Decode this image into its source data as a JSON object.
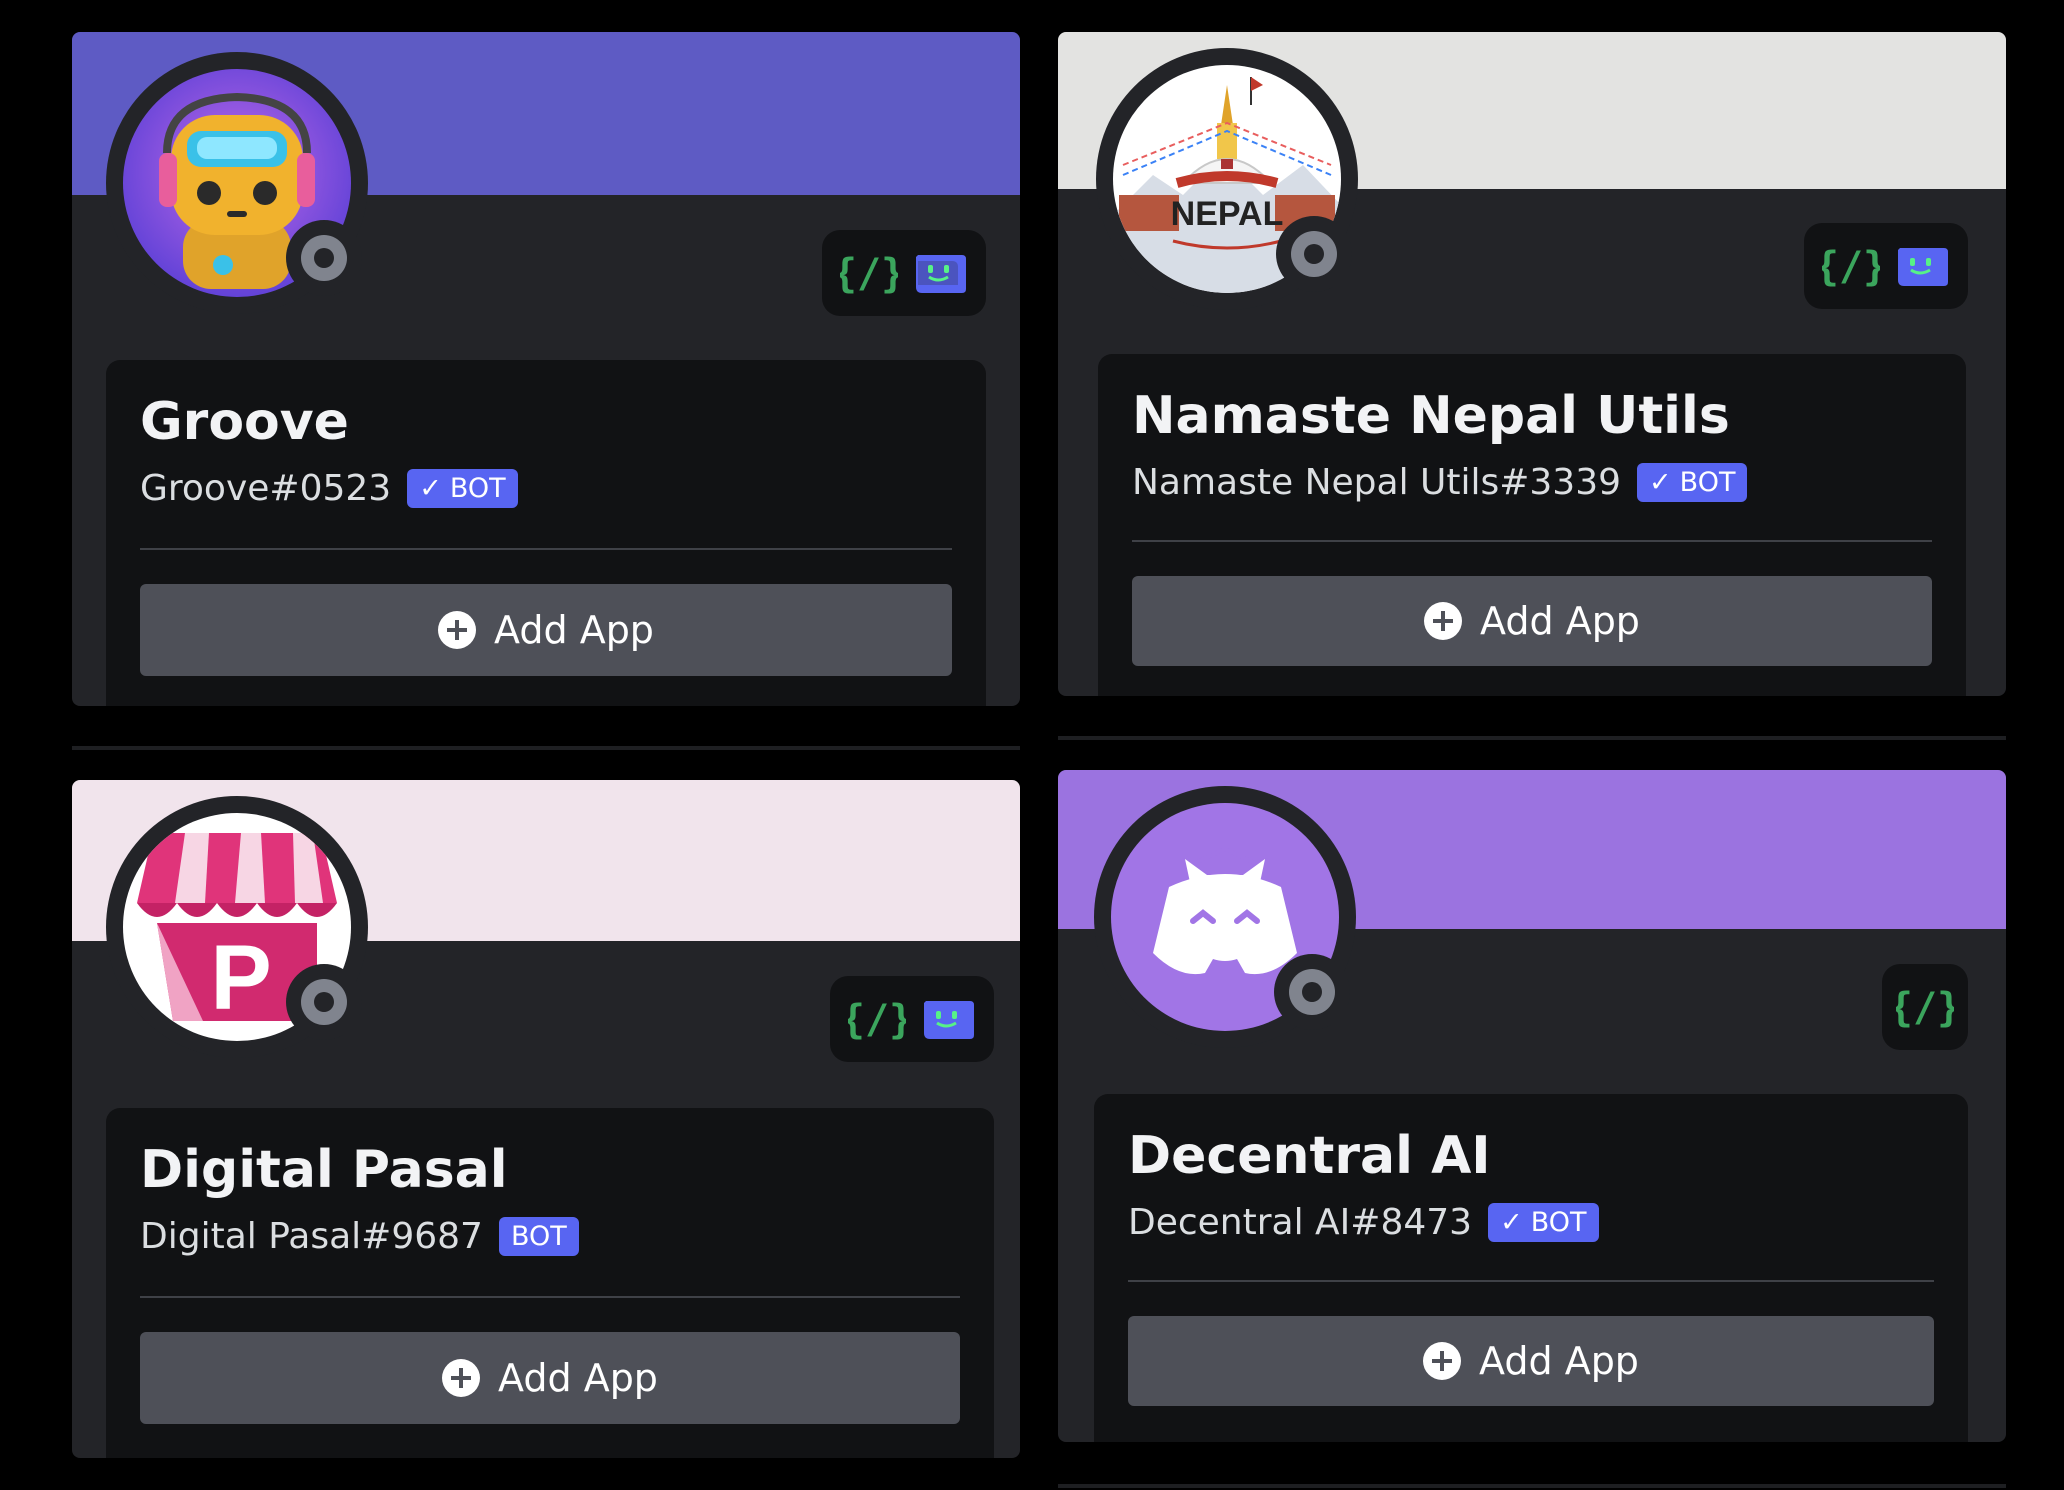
{
  "cards": [
    {
      "name": "Groove",
      "tag": "Groove#0523",
      "bot_label": "BOT",
      "verified": true,
      "banner_color": "#5e5bc4",
      "add_label": "Add App",
      "badges": [
        "slash-commands-icon",
        "bot-app-icon"
      ]
    },
    {
      "name": "Namaste Nepal Utils",
      "tag": "Namaste Nepal Utils#3339",
      "bot_label": "BOT",
      "verified": true,
      "banner_color": "#e3e3e1",
      "avatar_text": "NEPAL",
      "add_label": "Add App",
      "badges": [
        "slash-commands-icon",
        "bot-app-icon"
      ]
    },
    {
      "name": "Digital Pasal",
      "tag": "Digital Pasal#9687",
      "bot_label": "BOT",
      "verified": false,
      "banner_color": "#f1e4ec",
      "avatar_text": "P",
      "add_label": "Add App",
      "badges": [
        "slash-commands-icon",
        "bot-app-icon"
      ]
    },
    {
      "name": "Decentral AI",
      "tag": "Decentral AI#8473",
      "bot_label": "BOT",
      "verified": true,
      "banner_color": "#9b73e0",
      "add_label": "Add App",
      "badges": [
        "slash-commands-icon"
      ]
    }
  ],
  "colors": {
    "page_bg": "#000000",
    "card_bg": "#232428",
    "inner_bg": "#111214",
    "button_bg": "#4e5058",
    "bot_badge": "#5865f2",
    "slash_icon": "#3ba55d",
    "status_offline": "#80848e"
  }
}
